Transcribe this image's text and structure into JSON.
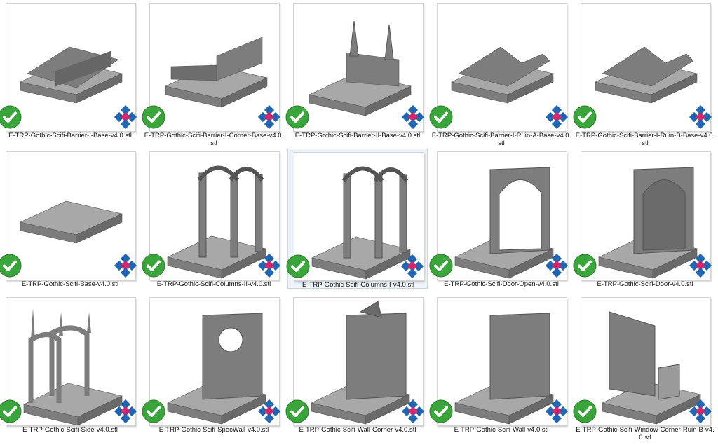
{
  "files": [
    {
      "name": "E-TRP-Gothic-Scifi-Barrier-I-Base-v4.0.stl",
      "model": "barrier",
      "selected": false
    },
    {
      "name": "E-TRP-Gothic-Scifi-Barrier-I-Corner-Base-v4.0.stl",
      "model": "corner",
      "selected": false
    },
    {
      "name": "E-TRP-Gothic-Scifi-Barrier-II-Base-v4.0.stl",
      "model": "spires",
      "selected": false
    },
    {
      "name": "E-TRP-Gothic-Scifi-Barrier-I-Ruin-A-Base-v4.0.stl",
      "model": "ruinA",
      "selected": false
    },
    {
      "name": "E-TRP-Gothic-Scifi-Barrier-I-Ruin-B-Base-v4.0.stl",
      "model": "ruinB",
      "selected": false
    },
    {
      "name": "E-TRP-Gothic-Scifi-Base-v4.0.stl",
      "model": "base",
      "selected": false
    },
    {
      "name": "E-TRP-Gothic-Scifi-Columns-II-v4.0.stl",
      "model": "columns2",
      "selected": false
    },
    {
      "name": "E-TRP-Gothic-Scifi-Columns-I-v4.0.stl",
      "model": "columns1",
      "selected": true
    },
    {
      "name": "E-TRP-Gothic-Scifi-Door-Open-v4.0.stl",
      "model": "dooropen",
      "selected": false
    },
    {
      "name": "E-TRP-Gothic-Scifi-Door-v4.0.stl",
      "model": "door",
      "selected": false
    },
    {
      "name": "E-TRP-Gothic-Scifi-Side-v4.0.stl",
      "model": "side",
      "selected": false
    },
    {
      "name": "E-TRP-Gothic-Scifi-SpecWall-v4.0.stl",
      "model": "specwall",
      "selected": false
    },
    {
      "name": "E-TRP-Gothic-Scifi-Wall-Corner-v4.0.stl",
      "model": "wallcorner",
      "selected": false
    },
    {
      "name": "E-TRP-Gothic-Scifi-Wall-v4.0.stl",
      "model": "wall",
      "selected": false
    },
    {
      "name": "E-TRP-Gothic-Scifi-Window-Corner-Ruin-B-v4.0.stl",
      "model": "window",
      "selected": false
    }
  ],
  "icons": {
    "status": "checkmark-icon",
    "overlay": "app-badge-icon"
  },
  "colors": {
    "check_green": "#3aa53a",
    "badge_blue": "#1f66b5",
    "badge_pink": "#d8246b",
    "model_gray": "#7d7d7d"
  }
}
